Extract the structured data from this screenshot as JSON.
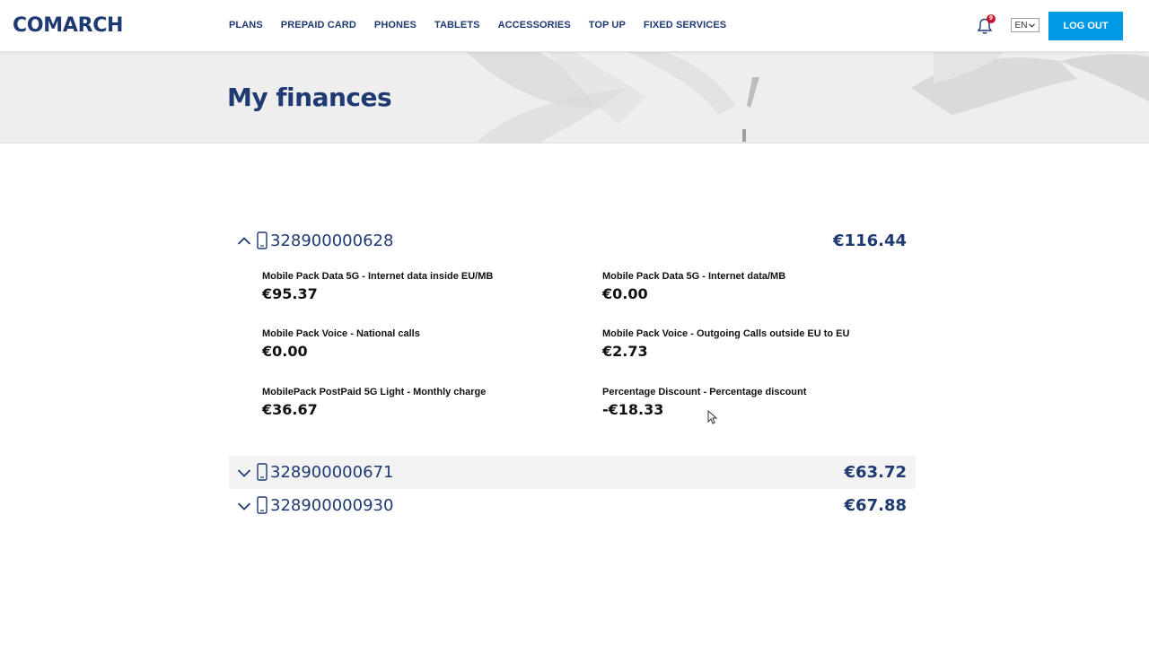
{
  "brand": {
    "logo_text": "COMARCH",
    "color": "#1f3a73",
    "accent": "#0099e6"
  },
  "nav": {
    "items": [
      {
        "label": "PLANS"
      },
      {
        "label": "PREPAID CARD"
      },
      {
        "label": "PHONES"
      },
      {
        "label": "TABLETS"
      },
      {
        "label": "ACCESSORIES"
      },
      {
        "label": "TOP UP"
      },
      {
        "label": "FIXED SERVICES"
      }
    ]
  },
  "header": {
    "notifications_icon": "bell-icon",
    "notifications_count": "9",
    "language": "EN",
    "logout_label": "LOG OUT"
  },
  "page": {
    "title": "My finances"
  },
  "accounts": [
    {
      "number": "328900000628",
      "total": "€116.44",
      "expanded": true,
      "charges": [
        {
          "label": "Mobile Pack Data 5G - Internet data inside EU/MB",
          "amount": "€95.37"
        },
        {
          "label": "Mobile Pack Data 5G - Internet data/MB",
          "amount": "€0.00"
        },
        {
          "label": "Mobile Pack Voice - National calls",
          "amount": "€0.00"
        },
        {
          "label": "Mobile Pack Voice - Outgoing Calls outside EU to EU",
          "amount": "€2.73"
        },
        {
          "label": "MobilePack PostPaid 5G Light - Monthly charge",
          "amount": "€36.67"
        },
        {
          "label": "Percentage Discount - Percentage discount",
          "amount": "-€18.33"
        }
      ]
    },
    {
      "number": "328900000671",
      "total": "€63.72",
      "expanded": false
    },
    {
      "number": "328900000930",
      "total": "€67.88",
      "expanded": false
    }
  ]
}
